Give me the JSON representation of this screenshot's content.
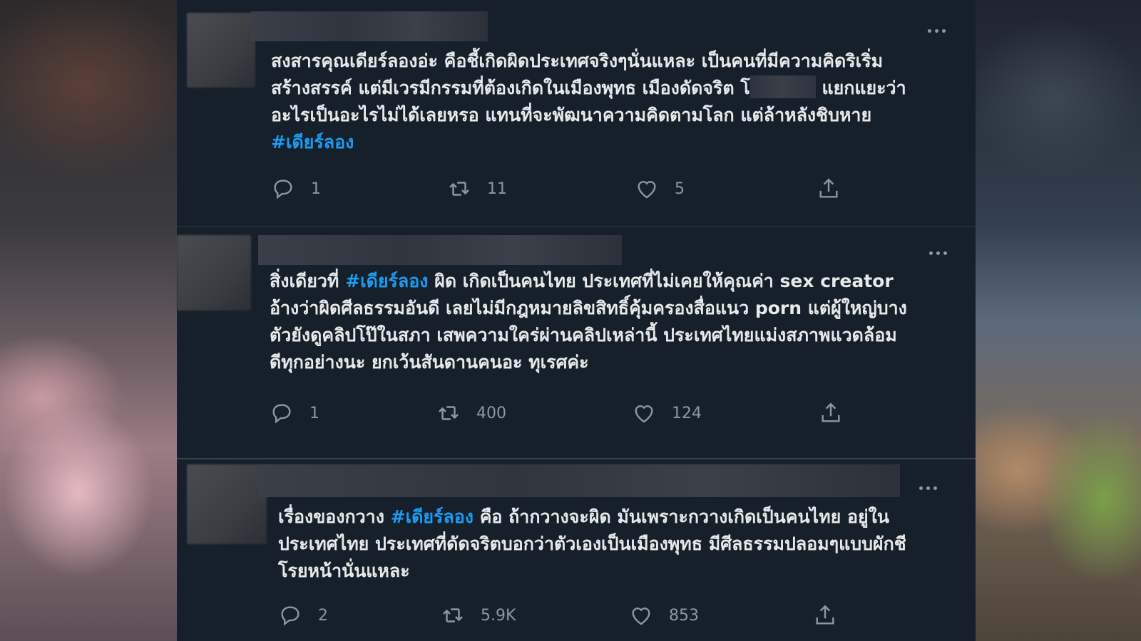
{
  "tweets": [
    {
      "body": {
        "p1": "สงสารคุณเดียร์ลองอ่ะ คือชี้เกิดผิดประเทศจริงๆนั่นแหละ เป็นคนที่มีความคิดริเริ่ม\nสร้างสรรค์ แต่มีเวรมีกรรมที่ต้องเกิดในเมืองพุทธ เมืองดัดจริต โ",
        "p2": " แยกแยะว่า\nอะไรเป็นอะไรไม่ได้เลยหรอ แทนที่จะพัฒนาความคิดตามโลก แต่ล้าหลังชิบหาย\n",
        "hashtag": "#เดียร์ลอง"
      },
      "reply_count": "1",
      "retweet_count": "11",
      "like_count": "5"
    },
    {
      "body": {
        "p1": "สิ่งเดียวที่ ",
        "hashtag": "#เดียร์ลอง",
        "p2": " ผิด เกิดเป็นคนไทย ประเทศที่ไม่เคยให้คุณค่า sex creator\nอ้างว่าผิดศีลธรรมอันดี เลยไม่มีกฎหมายลิขสิทธิ์คุ้มครองสื่อแนว porn แต่ผู้ใหญ่บาง\nตัวยังดูคลิปโป๊ในสภา เสพความใคร่ผ่านคลิปเหล่านี้ ประเทศไทยแม่งสภาพแวดล้อม\nดีทุกอย่างนะ ยกเว้นสันดานคนอะ ทุเรศค่ะ"
      },
      "reply_count": "1",
      "retweet_count": "400",
      "like_count": "124"
    },
    {
      "body": {
        "p1": "เรื่องของกวาง ",
        "hashtag": "#เดียร์ลอง",
        "p2": " คือ ถ้ากวางจะผิด มันเพราะกวางเกิดเป็นคนไทย อยู่ใน\nประเทศไทย ประเทศที่ดัดจริตบอกว่าตัวเองเป็นเมืองพุทธ มีศีลธรรมปลอมๆแบบผักชี\nโรยหน้านั่นแหละ"
      },
      "reply_count": "2",
      "retweet_count": "5.9K",
      "like_count": "853"
    }
  ],
  "colors": {
    "background": "#15202b",
    "text": "#e7e9ea",
    "muted": "#8b98a5",
    "hashtag": "#1d9bf0"
  },
  "icons": {
    "reply": "reply-icon",
    "retweet": "retweet-icon",
    "like": "heart-icon",
    "share": "share-icon",
    "more": "more-icon"
  }
}
